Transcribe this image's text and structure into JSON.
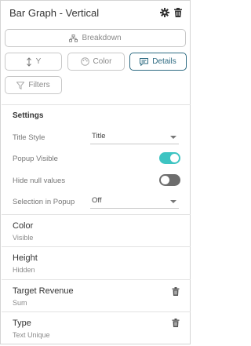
{
  "panel": {
    "title": "Bar Graph - Vertical"
  },
  "header_icons": {
    "settings": "gear-icon",
    "delete": "trash-icon"
  },
  "buttons": {
    "breakdown": {
      "label": "Breakdown",
      "icon": "hierarchy-icon"
    },
    "y": {
      "label": "Y",
      "icon": "vertical-arrows-icon"
    },
    "color": {
      "label": "Color",
      "icon": "palette-icon"
    },
    "details": {
      "label": "Details",
      "icon": "comment-icon",
      "active": true
    },
    "filters": {
      "label": "Filters",
      "icon": "filter-icon"
    }
  },
  "settings": {
    "heading": "Settings",
    "title_style": {
      "label": "Title Style",
      "value": "Title"
    },
    "popup_visible": {
      "label": "Popup Visible",
      "on": true
    },
    "hide_null": {
      "label": "Hide null values",
      "on": false
    },
    "selection_in_popup": {
      "label": "Selection in Popup",
      "value": "Off"
    }
  },
  "sections": [
    {
      "title": "Color",
      "sub": "Visible",
      "deletable": false
    },
    {
      "title": "Height",
      "sub": "Hidden",
      "deletable": false
    },
    {
      "title": "Target Revenue",
      "sub": "Sum",
      "deletable": true
    },
    {
      "title": "Type",
      "sub": "Text Unique",
      "deletable": true
    }
  ],
  "colors": {
    "accent": "#2e6b82",
    "toggle_on": "#3dc4c2",
    "toggle_off": "#6d6d6d"
  }
}
